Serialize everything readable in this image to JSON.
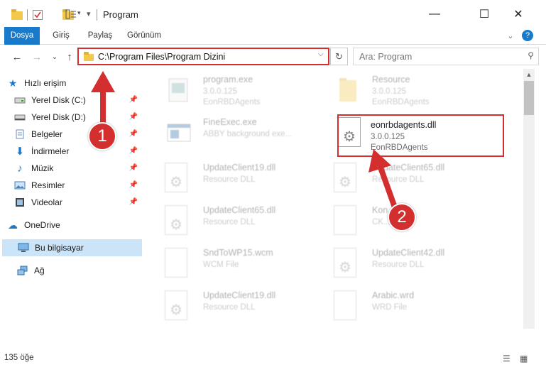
{
  "window": {
    "title": "Program",
    "minimize_glyph": "—",
    "maximize_glyph": "☐",
    "close_glyph": "✕"
  },
  "ribbon": {
    "tabs": [
      "Dosya",
      "Giriş",
      "Paylaş",
      "Görünüm"
    ],
    "expand_glyph": "⌄",
    "help_glyph": "?"
  },
  "address": {
    "path": "C:\\Program Files\\Program Dizini",
    "back_glyph": "←",
    "forward_glyph": "→",
    "recent_glyph": "⌄",
    "up_glyph": "↑",
    "dropdown_glyph": "⌵",
    "refresh_glyph": "↻"
  },
  "search": {
    "placeholder": "Ara: Program",
    "icon_glyph": "⚲"
  },
  "nav": {
    "quick_access": "Hızlı erişim",
    "items": [
      {
        "label": "Yerel Disk (C:)",
        "icon": "drive-icon"
      },
      {
        "label": "Yerel Disk (D:)",
        "icon": "drive-icon"
      },
      {
        "label": "Belgeler",
        "icon": "documents-icon"
      },
      {
        "label": "İndirmeler",
        "icon": "downloads-icon"
      },
      {
        "label": "Müzik",
        "icon": "music-icon"
      },
      {
        "label": "Resimler",
        "icon": "pictures-icon"
      },
      {
        "label": "Videolar",
        "icon": "videos-icon"
      }
    ],
    "onedrive": "OneDrive",
    "this_pc": "Bu bilgisayar",
    "network": "Ağ"
  },
  "files": [
    {
      "name": "program.exe",
      "l2": "3.0.0.125",
      "l3": "EonRBDAgents"
    },
    {
      "name": "Resource",
      "l2": "3.0.0.125",
      "l3": "EonRBDAgents"
    },
    {
      "name": "FineExec.exe",
      "l2": "ABBY background exe...",
      "l3": ""
    },
    {
      "name": "eonrbdagents.dll",
      "l2": "3.0.0.125",
      "l3": "EonRBDAgents"
    },
    {
      "name": "UpdateClient19.dll",
      "l2": "Resource DLL",
      "l3": ""
    },
    {
      "name": "UpdateClient65.dll",
      "l2": "Resource DLL",
      "l3": ""
    },
    {
      "name": "UpdateClient65.dll",
      "l2": "Resource DLL",
      "l3": ""
    },
    {
      "name": "Kon...",
      "l2": "CK...",
      "l3": ""
    },
    {
      "name": "SndToWP15.wcm",
      "l2": "WCM File",
      "l3": ""
    },
    {
      "name": "UpdateClient42.dll",
      "l2": "Resource DLL",
      "l3": ""
    },
    {
      "name": "UpdateClient19.dll",
      "l2": "Resource DLL",
      "l3": ""
    },
    {
      "name": "Arabic.wrd",
      "l2": "WRD File",
      "l3": ""
    }
  ],
  "status": {
    "count": "135 öğe"
  },
  "callouts": {
    "one": "1",
    "two": "2"
  },
  "colors": {
    "accent": "#1979ca",
    "highlight_red": "#d32f2f",
    "selected_nav": "#cce4f7"
  }
}
